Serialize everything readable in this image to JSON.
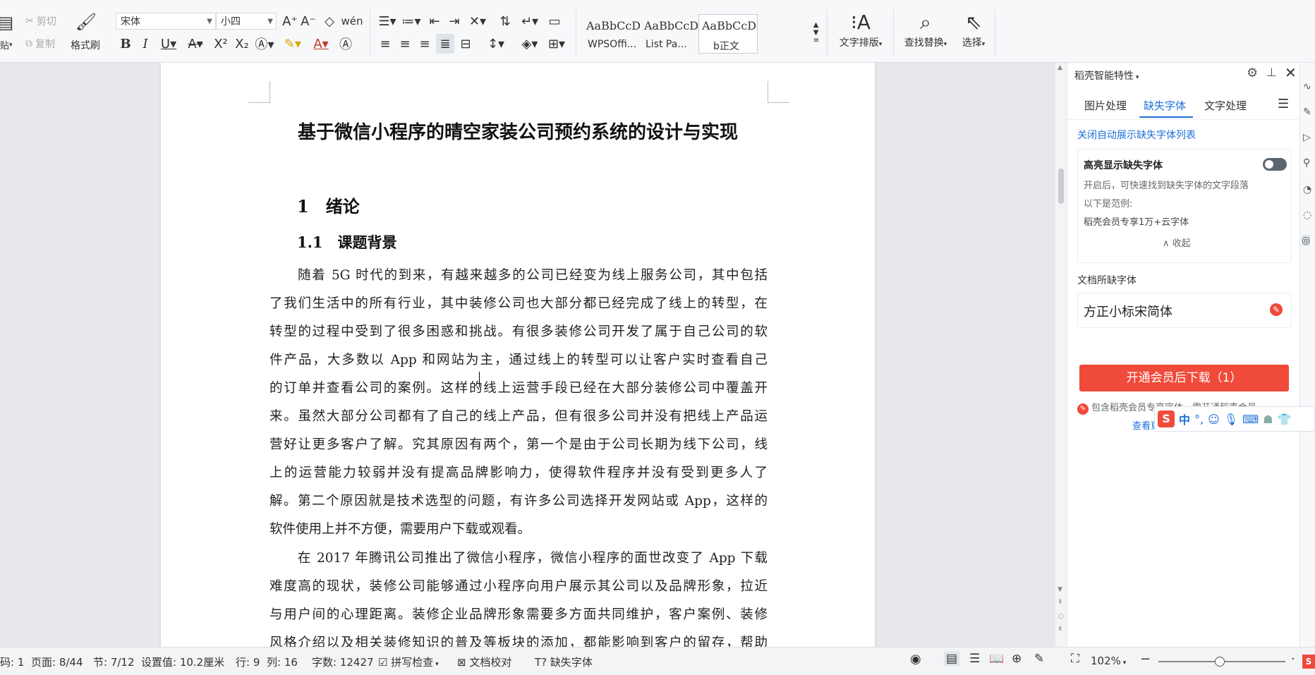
{
  "ribbon": {
    "clipboard": {
      "paste": "贴",
      "cut": "剪切",
      "copy": "复制",
      "format_painter": "格式刷"
    },
    "font": {
      "family": "宋体",
      "size": "小四"
    },
    "styles": [
      {
        "sample": "AaBbCcDd",
        "name": "WPSOffi..."
      },
      {
        "sample": "AaBbCcDd",
        "name": "List Pa..."
      },
      {
        "sample": "AaBbCcDd",
        "name": "b正文"
      }
    ],
    "text_layout": "文字排版",
    "find_replace": "查找替换",
    "select": "选择"
  },
  "document": {
    "title": "基于微信小程序的晴空家装公司预约系统的设计与实现",
    "h1": "1　绪论",
    "h2": "1.1　课题背景",
    "para1": [
      "随着 5G 时代的到来，有越来越多的公司已经变为线上服务公司，其中包括",
      "了我们生活中的所有行业，其中装修公司也大部分都已经完成了线上的转型，在",
      "转型的过程中受到了很多困惑和挑战。有很多装修公司开发了属于自己公司的软",
      "件产品，大多数以 App 和网站为主，通过线上的转型可以让客户实时查看自己",
      "的订单并查看公司的案例。这样的线上运营手段已经在大部分装修公司中覆盖开",
      "来。虽然大部分公司都有了自己的线上产品，但有很多公司并没有把线上产品运",
      "营好让更多客户了解。究其原因有两个，第一个是由于公司长期为线下公司，线",
      "上的运营能力较弱并没有提高品牌影响力，使得软件程序并没有受到更多人了",
      "解。第二个原因就是技术选型的问题，有许多公司选择开发网站或 App，这样的",
      "软件使用上并不方便，需要用户下载或观看。"
    ],
    "para2": [
      "在 2017 年腾讯公司推出了微信小程序，微信小程序的面世改变了 App 下载",
      "难度高的现状，装修公司能够通过小程序向用户展示其公司以及品牌形象，拉近",
      "与用户间的心理距离。装修企业品牌形象需要多方面共同维护，客户案例、装修",
      "风格介绍以及相关装修知识的普及等板块的添加，都能影响到客户的留存，帮助"
    ]
  },
  "panel": {
    "title": "稻壳智能特性",
    "tabs": [
      "图片处理",
      "缺失字体",
      "文字处理"
    ],
    "link_close_auto": "关闭自动展示缺失字体列表",
    "highlight_label": "高亮显示缺失字体",
    "highlight_desc": "开启后，可快速找到缺失字体的文字段落",
    "example_label": "以下是范例:",
    "example_text": "稻壳会员专享1万+云字体",
    "collapse": "收起",
    "missing_heading": "文档所缺字体",
    "missing_font": "方正小标宋简体",
    "download_button": "开通会员后下载（1）",
    "member_note": "包含稻壳会员专享字体，需开通稻壳会员",
    "more_fonts": "查看更多公文字体 ›"
  },
  "ime": {
    "lang": "中",
    "punct": "°,"
  },
  "status": {
    "page_code": "码: 1",
    "page": "页面: 8/44",
    "section": "节: 7/12",
    "setting": "设置值: 10.2厘米",
    "row": "行: 9",
    "col": "列: 16",
    "word_count": "字数: 12427",
    "spell_check": "拼写检查",
    "doc_proof": "文档校对",
    "missing_fonts": "缺失字体",
    "zoom": "102%"
  },
  "colors": {
    "accent": "#1e6fd9",
    "download": "#f04a3a",
    "docer": "#f04a3a"
  }
}
